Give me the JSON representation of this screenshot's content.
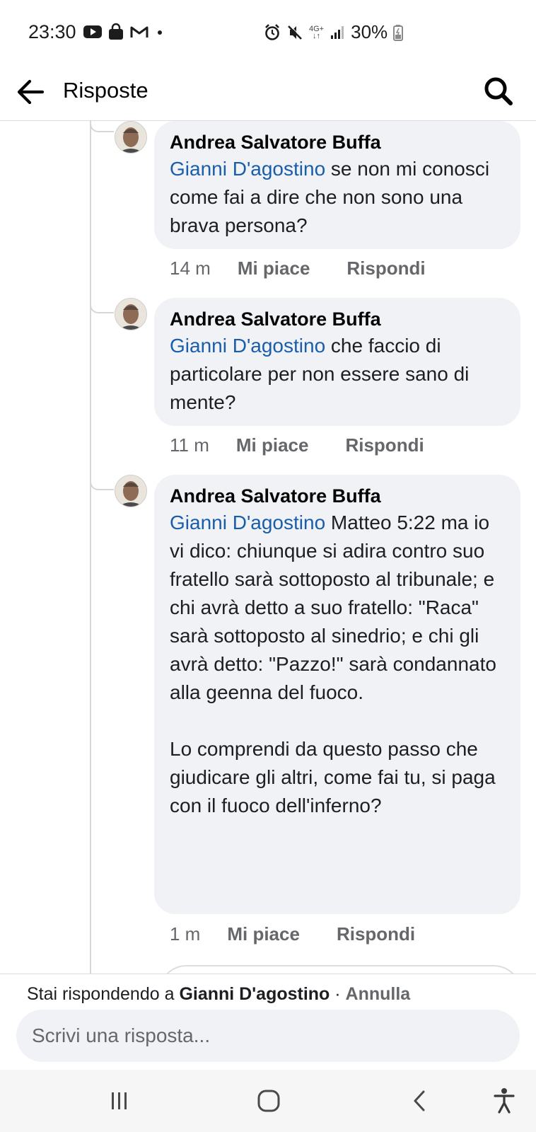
{
  "status_bar": {
    "time": "23:30",
    "left_icons": [
      "youtube-icon",
      "shopping-bag-icon",
      "gmail-icon",
      "dot-icon"
    ],
    "right_icons": [
      "alarm-icon",
      "mute-icon",
      "4g-signal-icon",
      "battery-icon"
    ],
    "network_label": "4G+",
    "battery_text": "30%"
  },
  "header": {
    "title": "Risposte",
    "back_icon": "arrow-left-icon",
    "search_icon": "search-icon"
  },
  "comments": [
    {
      "author": "Andrea Salvatore Buffa",
      "mention": "Gianni D'agostino",
      "text": " se non mi conosci come fai a dire che non sono una brava persona?",
      "time": "14 m",
      "like_label": "Mi piace",
      "reply_label": "Rispondi"
    },
    {
      "author": "Andrea Salvatore Buffa",
      "mention": "Gianni D'agostino",
      "text": " che faccio di particolare per non essere sano di mente?",
      "time": "11 m",
      "like_label": "Mi piace",
      "reply_label": "Rispondi"
    },
    {
      "author": "Andrea Salvatore Buffa",
      "mention": "Gianni D'agostino",
      "text": "  Matteo 5:22 ma io vi dico: chiunque si adira contro suo fratello sarà sottoposto al tribunale; e chi avrà detto a suo fratello: \"Raca\" sarà sottoposto al sinedrio; e chi gli avrà detto: \"Pazzo!\" sarà condannato alla geenna del fuoco.\n\nLo comprendi da questo passo che giudicare gli altri, come fai tu, si paga con il fuoco dell'inferno?",
      "time": "1 m",
      "like_label": "Mi piace",
      "reply_label": "Rispondi"
    }
  ],
  "reply_bar": {
    "prefix": "Stai rispondendo a ",
    "target": "Gianni D'agostino",
    "separator": " · ",
    "cancel_label": "Annulla",
    "input_placeholder": "Scrivi una risposta..."
  },
  "nav_bar": {
    "buttons": [
      "recent-apps-icon",
      "home-icon",
      "back-chevron-icon",
      "accessibility-icon"
    ]
  },
  "colors": {
    "mention": "#1a5dab",
    "bubble_bg": "#f0f2f5",
    "meta_text": "#65676b"
  }
}
